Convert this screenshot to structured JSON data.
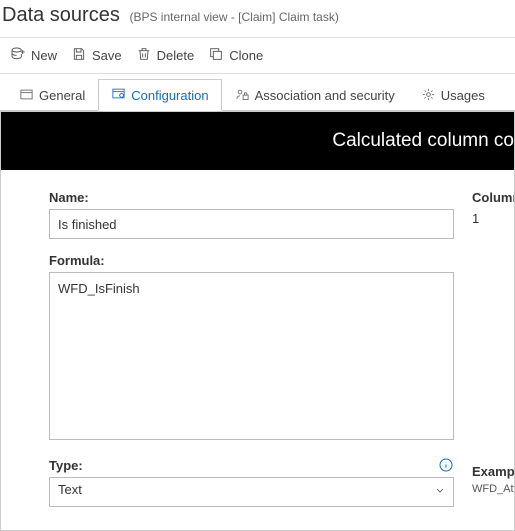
{
  "header": {
    "title": "Data sources",
    "subtitle": "(BPS internal view - [Claim] Claim task)"
  },
  "toolbar": {
    "new_label": "New",
    "save_label": "Save",
    "delete_label": "Delete",
    "clone_label": "Clone"
  },
  "tabs": {
    "general": "General",
    "configuration": "Configuration",
    "assoc": "Association and security",
    "usages": "Usages"
  },
  "panel": {
    "banner": "Calculated column co"
  },
  "form": {
    "name_label": "Name:",
    "name_value": "Is finished",
    "column_label": "Column",
    "column_value": "1",
    "formula_label": "Formula:",
    "formula_value": "WFD_IsFinish",
    "type_label": "Type:",
    "type_value": "Text",
    "example_label": "Exampl",
    "example_value": "WFD_Att"
  }
}
